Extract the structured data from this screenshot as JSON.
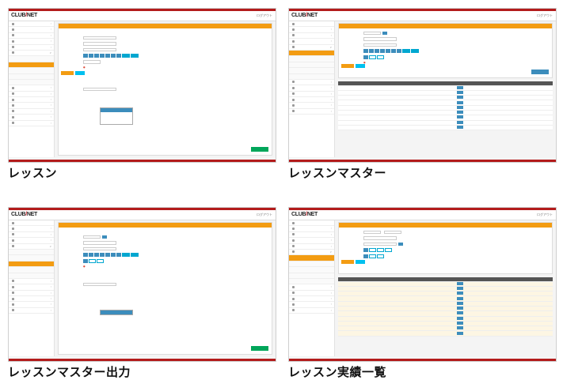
{
  "captions": {
    "lesson": "レッスン",
    "lesson_master": "レッスンマスター",
    "lesson_master_output": "レッスンマスター出力",
    "lesson_results_list": "レッスン実績一覧"
  },
  "app": {
    "logo_main": "CLUB",
    "logo_slash": "/",
    "logo_tail": "NET",
    "header_right": "ログアウト"
  },
  "colors": {
    "brand_red": "#b31b1b",
    "accent_orange": "#f39c12",
    "primary_blue": "#3c8dbc",
    "success_green": "#00a65a"
  }
}
